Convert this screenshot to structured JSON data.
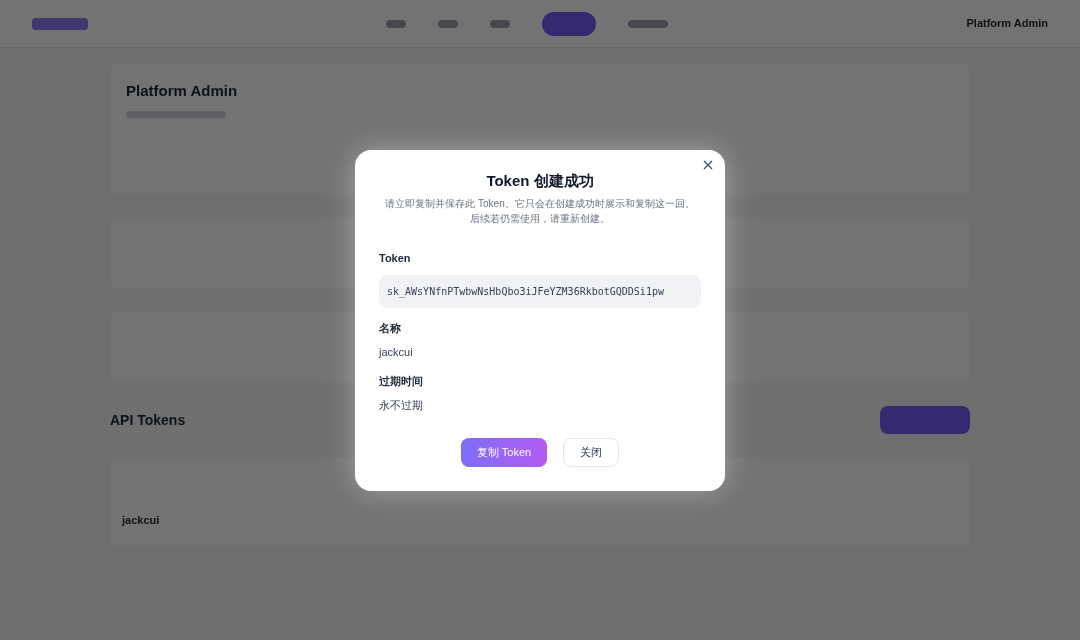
{
  "navbar": {
    "user": "Platform Admin"
  },
  "profile": {
    "name": "Platform Admin"
  },
  "tokens_section": {
    "title": "API Tokens",
    "rows": [
      {
        "name": "jackcui"
      }
    ]
  },
  "dialog": {
    "title": "Token 创建成功",
    "description": "请立即复制并保存此 Token。它只会在创建成功时展示和复制这一回。后续若仍需使用，请重新创建。",
    "fields": [
      {
        "label": "Token",
        "value": "sk_AWsYNfnPTwbwNsHbQbo3iJFeYZM36RkbotGQDDSi1pw",
        "kind": "code"
      },
      {
        "label": "名称",
        "value": "jackcui",
        "kind": "text"
      },
      {
        "label": "过期时间",
        "value": "永不过期",
        "kind": "text"
      }
    ],
    "buttons": [
      {
        "label": "复制 Token",
        "kind": "primary"
      },
      {
        "label": "关闭",
        "kind": "secondary"
      }
    ]
  }
}
